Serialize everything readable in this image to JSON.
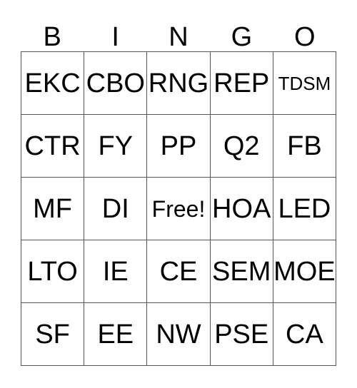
{
  "card": {
    "title": "BINGO",
    "header_letters": [
      "B",
      "I",
      "N",
      "G",
      "O"
    ],
    "free_space_label": "Free!",
    "colors": {
      "background": "#ffffff",
      "grid_line": "#555555",
      "text": "#000000"
    },
    "rows": [
      [
        {
          "label": "EKC",
          "size": "normal"
        },
        {
          "label": "CBO",
          "size": "normal"
        },
        {
          "label": "RNG",
          "size": "normal"
        },
        {
          "label": "REP",
          "size": "normal"
        },
        {
          "label": "TDSM",
          "size": "small"
        }
      ],
      [
        {
          "label": "CTR",
          "size": "normal"
        },
        {
          "label": "FY",
          "size": "normal"
        },
        {
          "label": "PP",
          "size": "normal"
        },
        {
          "label": "Q2",
          "size": "normal"
        },
        {
          "label": "FB",
          "size": "normal"
        }
      ],
      [
        {
          "label": "MF",
          "size": "normal"
        },
        {
          "label": "DI",
          "size": "normal"
        },
        {
          "label": "Free!",
          "size": "medium"
        },
        {
          "label": "HOA",
          "size": "normal"
        },
        {
          "label": "LED",
          "size": "normal"
        }
      ],
      [
        {
          "label": "LTO",
          "size": "normal"
        },
        {
          "label": "IE",
          "size": "normal"
        },
        {
          "label": "CE",
          "size": "normal"
        },
        {
          "label": "SEM",
          "size": "normal"
        },
        {
          "label": "MOE",
          "size": "normal"
        }
      ],
      [
        {
          "label": "SF",
          "size": "normal"
        },
        {
          "label": "EE",
          "size": "normal"
        },
        {
          "label": "NW",
          "size": "normal"
        },
        {
          "label": "PSE",
          "size": "normal"
        },
        {
          "label": "CA",
          "size": "normal"
        }
      ]
    ]
  }
}
